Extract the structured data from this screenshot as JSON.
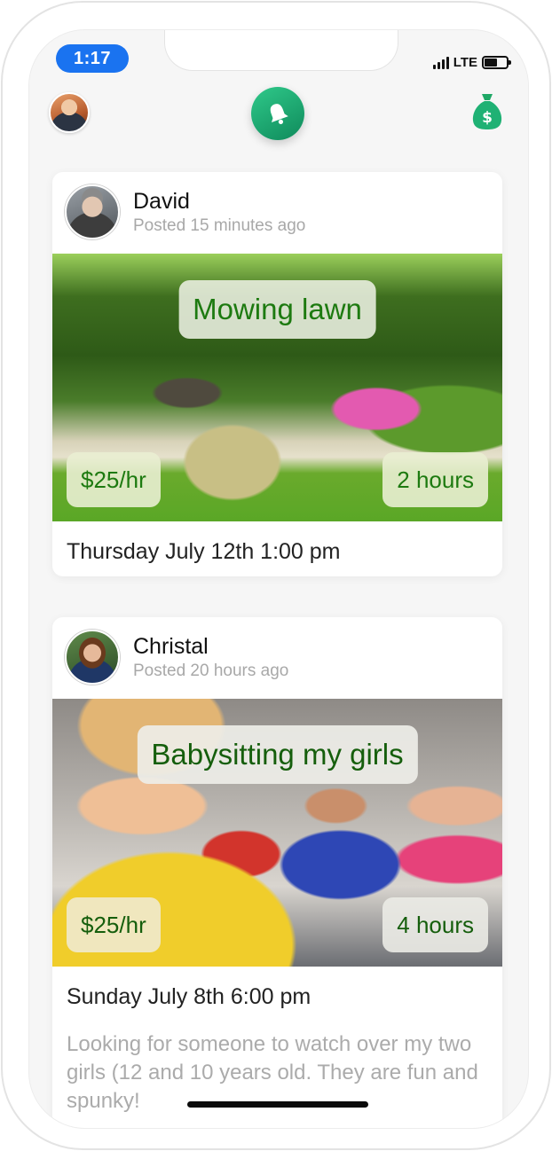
{
  "status_bar": {
    "time": "1:17",
    "network": "LTE"
  },
  "header": {
    "profile_icon": "user-avatar",
    "center_icon": "bell-icon",
    "right_icon": "money-bag-icon",
    "accent_color": "#1fb174"
  },
  "posts": [
    {
      "author": "David",
      "posted": "Posted 15 minutes ago",
      "title": "Mowing lawn",
      "rate": "$25/hr",
      "duration": "2 hours",
      "date": "Thursday July 12th 1:00 pm",
      "description": ""
    },
    {
      "author": "Christal",
      "posted": "Posted 20 hours ago",
      "title": "Babysitting my girls",
      "rate": "$25/hr",
      "duration": "4 hours",
      "date": "Sunday July 8th 6:00 pm",
      "description": "Looking for someone to watch over my two girls (12 and 10 years old. They are fun and spunky!"
    }
  ]
}
